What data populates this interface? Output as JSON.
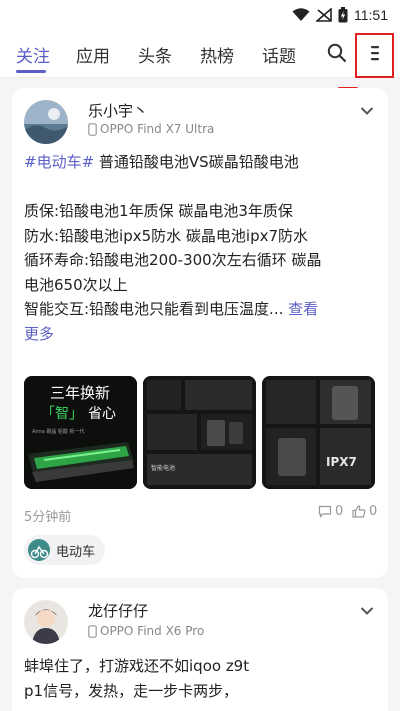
{
  "status_bar": {
    "time": "11:51"
  },
  "nav": {
    "tabs": [
      {
        "label": "关注",
        "active": true
      },
      {
        "label": "应用"
      },
      {
        "label": "头条"
      },
      {
        "label": "热榜"
      },
      {
        "label": "话题"
      }
    ]
  },
  "colors": {
    "accent": "#5b5fc7",
    "annotation": "#e02020"
  },
  "posts": [
    {
      "username": "乐小宇丶",
      "device": "OPPO Find X7 Ultra",
      "hashtag": "#电动车#",
      "title": " 普通铅酸电池VS碳晶铅酸电池",
      "lines": [
        "质保:铅酸电池1年质保 碳晶电池3年质保",
        "防水:铅酸电池ipx5防水 碳晶电池ipx7防水",
        "循环寿命:铅酸电池200-300次左右循环 碳晶",
        "电池650次以上"
      ],
      "last_line": "智能交互:铅酸电池只能看到电压温度...",
      "more_prefix": " 查看",
      "more_suffix": "更多",
      "images": [
        {
          "headline": "三年换新",
          "sub_left": "「智」",
          "sub_right": "省心",
          "caption": "Aima 碳晶 铅酸 新一代"
        },
        {
          "caption": "智能电池"
        },
        {
          "caption": "IPX7"
        }
      ],
      "time": "5分钟前",
      "comments": "0",
      "likes": "0",
      "topic": "电动车"
    },
    {
      "username": "龙仔仔仔",
      "device": "OPPO Find X6 Pro",
      "lines": [
        "蚌埠住了，打游戏还不如iqoo z9t",
        "p1信号，发热，走一步卡两步，"
      ]
    }
  ]
}
